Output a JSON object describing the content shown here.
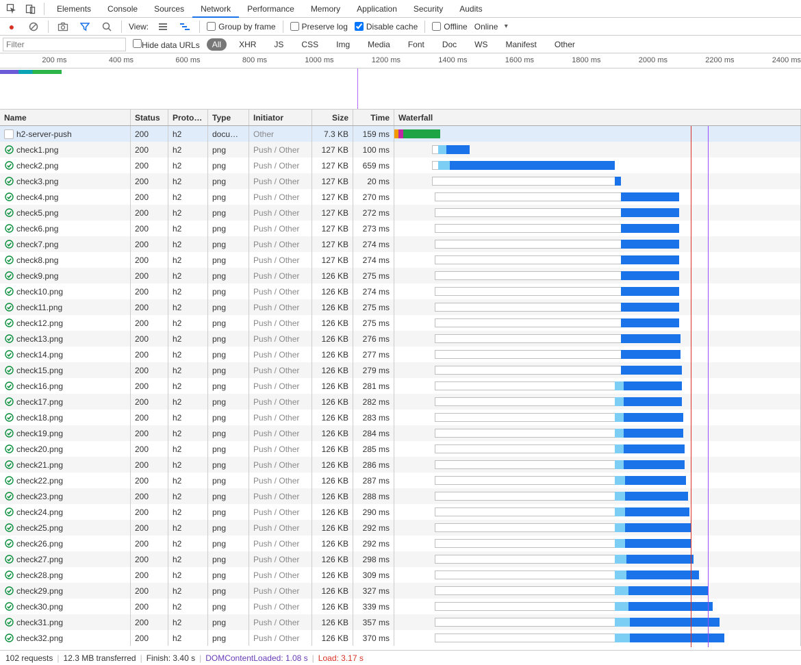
{
  "tabs": [
    "Elements",
    "Console",
    "Sources",
    "Network",
    "Performance",
    "Memory",
    "Application",
    "Security",
    "Audits"
  ],
  "active_tab": "Network",
  "toolbar": {
    "view_label": "View:",
    "group_by_frame": "Group by frame",
    "preserve_log": "Preserve log",
    "disable_cache": "Disable cache",
    "disable_cache_checked": true,
    "offline": "Offline",
    "online": "Online"
  },
  "filter": {
    "placeholder": "Filter",
    "hide_data_urls": "Hide data URLs",
    "types": [
      "All",
      "XHR",
      "JS",
      "CSS",
      "Img",
      "Media",
      "Font",
      "Doc",
      "WS",
      "Manifest",
      "Other"
    ],
    "active_type": "All"
  },
  "ruler": {
    "ticks": [
      200,
      400,
      600,
      800,
      1000,
      1200,
      1400,
      1600,
      1800,
      2000,
      2200,
      2400
    ],
    "unit": "ms"
  },
  "overview": {
    "marker_ms": 1070
  },
  "columns": [
    "Name",
    "Status",
    "Proto…",
    "Type",
    "Initiator",
    "Size",
    "Time",
    "Waterfall"
  ],
  "waterfall": {
    "domain_ms": 1400,
    "dcl_ms": 1080,
    "load_ms": 1020
  },
  "requests": [
    {
      "name": "h2-server-push",
      "status": "200",
      "proto": "h2",
      "type": "docu…",
      "initiator": "Other",
      "size": "7.3 KB",
      "time": "159 ms",
      "selected": true,
      "icon": "doc",
      "wf": {
        "segments": [
          {
            "start": 0,
            "len": 14,
            "kind": "dns"
          },
          {
            "start": 14,
            "len": 10,
            "kind": "ssl"
          },
          {
            "start": 24,
            "len": 7,
            "kind": "ssl"
          },
          {
            "start": 31,
            "len": 128,
            "kind": "ttfb"
          }
        ]
      }
    },
    {
      "name": "check1.png",
      "status": "200",
      "proto": "h2",
      "type": "png",
      "initiator": "Push / Other",
      "size": "127 KB",
      "time": "100 ms",
      "icon": "img",
      "wf": {
        "wait": [
          130,
          20
        ],
        "conn": [
          150,
          30
        ],
        "dl": [
          180,
          80
        ]
      }
    },
    {
      "name": "check2.png",
      "status": "200",
      "proto": "h2",
      "type": "png",
      "initiator": "Push / Other",
      "size": "127 KB",
      "time": "659 ms",
      "icon": "img",
      "wf": {
        "wait": [
          130,
          20
        ],
        "conn": [
          150,
          40
        ],
        "dl": [
          190,
          570
        ]
      }
    },
    {
      "name": "check3.png",
      "status": "200",
      "proto": "h2",
      "type": "png",
      "initiator": "Push / Other",
      "size": "127 KB",
      "time": "20 ms",
      "icon": "img",
      "wf": {
        "wait": [
          130,
          630
        ],
        "dl": [
          760,
          20
        ]
      }
    },
    {
      "name": "check4.png",
      "status": "200",
      "proto": "h2",
      "type": "png",
      "initiator": "Push / Other",
      "size": "127 KB",
      "time": "270 ms",
      "icon": "img",
      "wf": {
        "wait": [
          140,
          640
        ],
        "dl": [
          780,
          200
        ]
      }
    },
    {
      "name": "check5.png",
      "status": "200",
      "proto": "h2",
      "type": "png",
      "initiator": "Push / Other",
      "size": "127 KB",
      "time": "272 ms",
      "icon": "img",
      "wf": {
        "wait": [
          140,
          640
        ],
        "dl": [
          780,
          200
        ]
      }
    },
    {
      "name": "check6.png",
      "status": "200",
      "proto": "h2",
      "type": "png",
      "initiator": "Push / Other",
      "size": "127 KB",
      "time": "273 ms",
      "icon": "img",
      "wf": {
        "wait": [
          140,
          640
        ],
        "dl": [
          780,
          200
        ]
      }
    },
    {
      "name": "check7.png",
      "status": "200",
      "proto": "h2",
      "type": "png",
      "initiator": "Push / Other",
      "size": "127 KB",
      "time": "274 ms",
      "icon": "img",
      "wf": {
        "wait": [
          140,
          640
        ],
        "dl": [
          780,
          200
        ]
      }
    },
    {
      "name": "check8.png",
      "status": "200",
      "proto": "h2",
      "type": "png",
      "initiator": "Push / Other",
      "size": "127 KB",
      "time": "274 ms",
      "icon": "img",
      "wf": {
        "wait": [
          140,
          640
        ],
        "dl": [
          780,
          200
        ]
      }
    },
    {
      "name": "check9.png",
      "status": "200",
      "proto": "h2",
      "type": "png",
      "initiator": "Push / Other",
      "size": "126 KB",
      "time": "275 ms",
      "icon": "img",
      "wf": {
        "wait": [
          140,
          640
        ],
        "dl": [
          780,
          200
        ]
      }
    },
    {
      "name": "check10.png",
      "status": "200",
      "proto": "h2",
      "type": "png",
      "initiator": "Push / Other",
      "size": "126 KB",
      "time": "274 ms",
      "icon": "img",
      "wf": {
        "wait": [
          140,
          640
        ],
        "dl": [
          780,
          200
        ]
      }
    },
    {
      "name": "check11.png",
      "status": "200",
      "proto": "h2",
      "type": "png",
      "initiator": "Push / Other",
      "size": "126 KB",
      "time": "275 ms",
      "icon": "img",
      "wf": {
        "wait": [
          140,
          640
        ],
        "dl": [
          780,
          200
        ]
      }
    },
    {
      "name": "check12.png",
      "status": "200",
      "proto": "h2",
      "type": "png",
      "initiator": "Push / Other",
      "size": "126 KB",
      "time": "275 ms",
      "icon": "img",
      "wf": {
        "wait": [
          140,
          640
        ],
        "dl": [
          780,
          200
        ]
      }
    },
    {
      "name": "check13.png",
      "status": "200",
      "proto": "h2",
      "type": "png",
      "initiator": "Push / Other",
      "size": "126 KB",
      "time": "276 ms",
      "icon": "img",
      "wf": {
        "wait": [
          140,
          640
        ],
        "dl": [
          780,
          205
        ]
      }
    },
    {
      "name": "check14.png",
      "status": "200",
      "proto": "h2",
      "type": "png",
      "initiator": "Push / Other",
      "size": "126 KB",
      "time": "277 ms",
      "icon": "img",
      "wf": {
        "wait": [
          140,
          640
        ],
        "dl": [
          780,
          205
        ]
      }
    },
    {
      "name": "check15.png",
      "status": "200",
      "proto": "h2",
      "type": "png",
      "initiator": "Push / Other",
      "size": "126 KB",
      "time": "279 ms",
      "icon": "img",
      "wf": {
        "wait": [
          140,
          640
        ],
        "dl": [
          780,
          210
        ]
      }
    },
    {
      "name": "check16.png",
      "status": "200",
      "proto": "h2",
      "type": "png",
      "initiator": "Push / Other",
      "size": "126 KB",
      "time": "281 ms",
      "icon": "img",
      "wf": {
        "wait": [
          140,
          620
        ],
        "conn": [
          760,
          30
        ],
        "dl": [
          790,
          200
        ]
      }
    },
    {
      "name": "check17.png",
      "status": "200",
      "proto": "h2",
      "type": "png",
      "initiator": "Push / Other",
      "size": "126 KB",
      "time": "282 ms",
      "icon": "img",
      "wf": {
        "wait": [
          140,
          620
        ],
        "conn": [
          760,
          30
        ],
        "dl": [
          790,
          200
        ]
      }
    },
    {
      "name": "check18.png",
      "status": "200",
      "proto": "h2",
      "type": "png",
      "initiator": "Push / Other",
      "size": "126 KB",
      "time": "283 ms",
      "icon": "img",
      "wf": {
        "wait": [
          140,
          620
        ],
        "conn": [
          760,
          30
        ],
        "dl": [
          790,
          205
        ]
      }
    },
    {
      "name": "check19.png",
      "status": "200",
      "proto": "h2",
      "type": "png",
      "initiator": "Push / Other",
      "size": "126 KB",
      "time": "284 ms",
      "icon": "img",
      "wf": {
        "wait": [
          140,
          620
        ],
        "conn": [
          760,
          30
        ],
        "dl": [
          790,
          205
        ]
      }
    },
    {
      "name": "check20.png",
      "status": "200",
      "proto": "h2",
      "type": "png",
      "initiator": "Push / Other",
      "size": "126 KB",
      "time": "285 ms",
      "icon": "img",
      "wf": {
        "wait": [
          140,
          620
        ],
        "conn": [
          760,
          30
        ],
        "dl": [
          790,
          210
        ]
      }
    },
    {
      "name": "check21.png",
      "status": "200",
      "proto": "h2",
      "type": "png",
      "initiator": "Push / Other",
      "size": "126 KB",
      "time": "286 ms",
      "icon": "img",
      "wf": {
        "wait": [
          140,
          620
        ],
        "conn": [
          760,
          30
        ],
        "dl": [
          790,
          210
        ]
      }
    },
    {
      "name": "check22.png",
      "status": "200",
      "proto": "h2",
      "type": "png",
      "initiator": "Push / Other",
      "size": "126 KB",
      "time": "287 ms",
      "icon": "img",
      "wf": {
        "wait": [
          140,
          620
        ],
        "conn": [
          760,
          35
        ],
        "dl": [
          795,
          210
        ]
      }
    },
    {
      "name": "check23.png",
      "status": "200",
      "proto": "h2",
      "type": "png",
      "initiator": "Push / Other",
      "size": "126 KB",
      "time": "288 ms",
      "icon": "img",
      "wf": {
        "wait": [
          140,
          620
        ],
        "conn": [
          760,
          35
        ],
        "dl": [
          795,
          215
        ]
      }
    },
    {
      "name": "check24.png",
      "status": "200",
      "proto": "h2",
      "type": "png",
      "initiator": "Push / Other",
      "size": "126 KB",
      "time": "290 ms",
      "icon": "img",
      "wf": {
        "wait": [
          140,
          620
        ],
        "conn": [
          760,
          35
        ],
        "dl": [
          795,
          220
        ]
      }
    },
    {
      "name": "check25.png",
      "status": "200",
      "proto": "h2",
      "type": "png",
      "initiator": "Push / Other",
      "size": "126 KB",
      "time": "292 ms",
      "icon": "img",
      "wf": {
        "wait": [
          140,
          620
        ],
        "conn": [
          760,
          35
        ],
        "dl": [
          795,
          225
        ]
      }
    },
    {
      "name": "check26.png",
      "status": "200",
      "proto": "h2",
      "type": "png",
      "initiator": "Push / Other",
      "size": "126 KB",
      "time": "292 ms",
      "icon": "img",
      "wf": {
        "wait": [
          140,
          620
        ],
        "conn": [
          760,
          35
        ],
        "dl": [
          795,
          225
        ]
      }
    },
    {
      "name": "check27.png",
      "status": "200",
      "proto": "h2",
      "type": "png",
      "initiator": "Push / Other",
      "size": "126 KB",
      "time": "298 ms",
      "icon": "img",
      "wf": {
        "wait": [
          140,
          620
        ],
        "conn": [
          760,
          40
        ],
        "dl": [
          800,
          230
        ]
      }
    },
    {
      "name": "check28.png",
      "status": "200",
      "proto": "h2",
      "type": "png",
      "initiator": "Push / Other",
      "size": "126 KB",
      "time": "309 ms",
      "icon": "img",
      "wf": {
        "wait": [
          140,
          620
        ],
        "conn": [
          760,
          40
        ],
        "dl": [
          800,
          250
        ]
      }
    },
    {
      "name": "check29.png",
      "status": "200",
      "proto": "h2",
      "type": "png",
      "initiator": "Push / Other",
      "size": "126 KB",
      "time": "327 ms",
      "icon": "img",
      "wf": {
        "wait": [
          140,
          620
        ],
        "conn": [
          760,
          45
        ],
        "dl": [
          805,
          275
        ]
      }
    },
    {
      "name": "check30.png",
      "status": "200",
      "proto": "h2",
      "type": "png",
      "initiator": "Push / Other",
      "size": "126 KB",
      "time": "339 ms",
      "icon": "img",
      "wf": {
        "wait": [
          140,
          620
        ],
        "conn": [
          760,
          45
        ],
        "dl": [
          805,
          290
        ]
      }
    },
    {
      "name": "check31.png",
      "status": "200",
      "proto": "h2",
      "type": "png",
      "initiator": "Push / Other",
      "size": "126 KB",
      "time": "357 ms",
      "icon": "img",
      "wf": {
        "wait": [
          140,
          620
        ],
        "conn": [
          760,
          50
        ],
        "dl": [
          810,
          310
        ]
      }
    },
    {
      "name": "check32.png",
      "status": "200",
      "proto": "h2",
      "type": "png",
      "initiator": "Push / Other",
      "size": "126 KB",
      "time": "370 ms",
      "icon": "img",
      "wf": {
        "wait": [
          140,
          620
        ],
        "conn": [
          760,
          50
        ],
        "dl": [
          810,
          325
        ]
      }
    }
  ],
  "status": {
    "requests": "102 requests",
    "transferred": "12.3 MB transferred",
    "finish_label": "Finish:",
    "finish": "3.40 s",
    "dcl_label": "DOMContentLoaded:",
    "dcl": "1.08 s",
    "load_label": "Load:",
    "load": "3.17 s"
  }
}
